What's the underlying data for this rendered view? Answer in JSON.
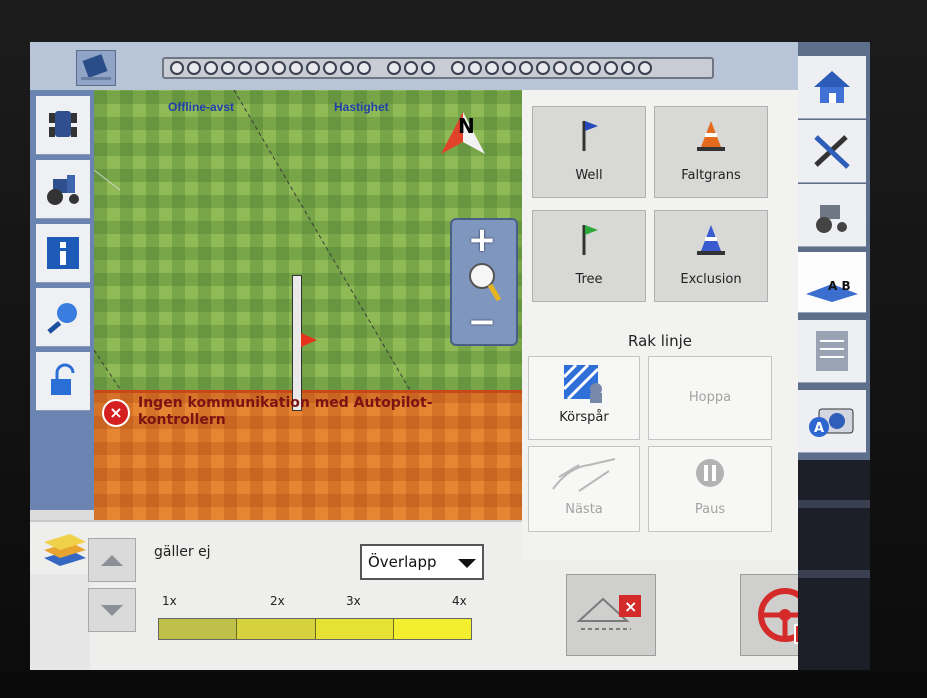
{
  "topbar": {
    "led_count_left": 12,
    "led_count_mid": 3,
    "led_count_right": 12
  },
  "left_toolbar": {
    "items": [
      {
        "icon": "tractor-top-icon"
      },
      {
        "icon": "tractor-icon"
      },
      {
        "icon": "info-icon"
      },
      {
        "icon": "magnifier-icon"
      },
      {
        "icon": "unlock-icon"
      }
    ]
  },
  "map": {
    "label_offline": "Offline-avst",
    "label_speed": "Hastighet",
    "compass_letter": "N",
    "zoom_plus": "+",
    "zoom_minus": "−",
    "alert_text": "Ingen kommunikation med Autopilot-kontrollern"
  },
  "bottom_left": {
    "status": "gäller ej",
    "dropdown_value": "Överlapp",
    "scale_labels": [
      "1x",
      "2x",
      "3x",
      "4x"
    ],
    "colors": {
      "seg1": "#bfc04a",
      "seg2": "#d5d23e",
      "seg3": "#e6e234",
      "seg4": "#f3ee2e"
    }
  },
  "markers": {
    "well": "Well",
    "field_boundary": "Faltgrans",
    "tree": "Tree",
    "exclusion": "Exclusion"
  },
  "guidance": {
    "heading": "Rak linje",
    "korspar": "Körspår",
    "hoppa": "Hoppa",
    "nasta": "Nästa",
    "paus": "Paus"
  },
  "right_toolbar": {
    "items": [
      {
        "icon": "home-icon"
      },
      {
        "icon": "tools-icon"
      },
      {
        "icon": "tractor-settings-icon"
      },
      {
        "icon": "ab-line-icon",
        "label": "A B"
      },
      {
        "icon": "controller-icon"
      },
      {
        "icon": "camera-a-icon",
        "label": "A"
      }
    ]
  },
  "accent_colors": {
    "map_green": "#8fba55",
    "map_orange": "#e78533",
    "alert_red": "#d42020",
    "toolbar_blue": "#6b84b1"
  }
}
